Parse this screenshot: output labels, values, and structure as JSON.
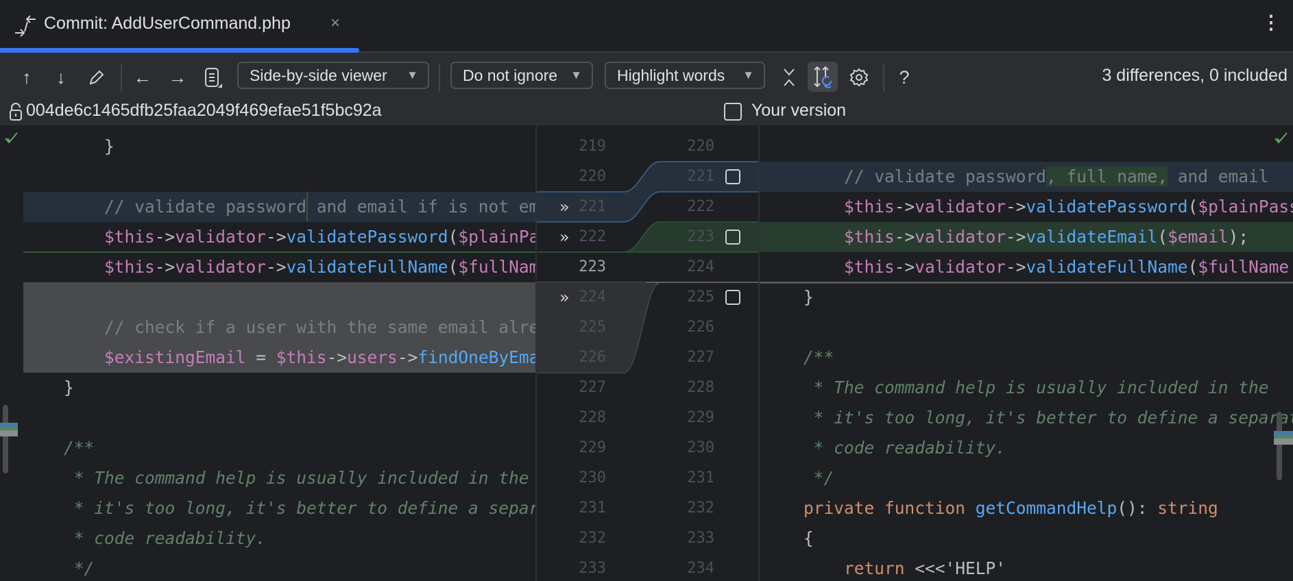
{
  "tab": {
    "title": "Commit: AddUserCommand.php",
    "close": "×",
    "more": "⋮"
  },
  "toolbar": {
    "viewer_dropdown": "Side-by-side viewer",
    "ignore_dropdown": "Do not ignore",
    "highlight_dropdown": "Highlight words",
    "help": "?",
    "status": "3 differences, 0 included"
  },
  "left_header": {
    "revision": "004de6c1465dfb25faa2049f469efae51f5bc92a"
  },
  "right_header": {
    "label": "Your version"
  },
  "colors": {
    "accent": "#3574f0",
    "modified_bg": "#25303c",
    "inserted_bg": "#283d30",
    "deleted_bg": "#484a4c"
  },
  "left_numbers": [
    "219",
    "220",
    "221",
    "222",
    "223",
    "224",
    "225",
    "226",
    "227",
    "228",
    "229",
    "230",
    "231",
    "232",
    "233"
  ],
  "right_numbers": [
    "220",
    "221",
    "222",
    "223",
    "224",
    "225",
    "226",
    "227",
    "228",
    "229",
    "230",
    "231",
    "232",
    "233",
    "234"
  ],
  "left_lines": [
    [
      [
        8,
        ""
      ],
      [
        "}",
        "op"
      ]
    ],
    [],
    [
      [
        8,
        ""
      ],
      [
        "// validate password",
        "cm"
      ],
      [
        " and email if is not empty",
        "cm"
      ]
    ],
    [
      [
        8,
        ""
      ],
      [
        "$this",
        "var"
      ],
      [
        "->",
        "op"
      ],
      [
        "validator",
        "prop"
      ],
      [
        "->",
        "op"
      ],
      [
        "validatePassword",
        "fn"
      ],
      [
        "(",
        "op"
      ],
      [
        "$plainPassword",
        "var"
      ],
      [
        ");",
        "op"
      ]
    ],
    [
      [
        8,
        ""
      ],
      [
        "$this",
        "var"
      ],
      [
        "->",
        "op"
      ],
      [
        "validator",
        "prop"
      ],
      [
        "->",
        "op"
      ],
      [
        "validateFullName",
        "fn"
      ],
      [
        "(",
        "op"
      ],
      [
        "$fullName",
        "var"
      ],
      [
        ");",
        "op"
      ]
    ],
    [],
    [
      [
        8,
        ""
      ],
      [
        "// check if a user with the same email already exists",
        "cm"
      ]
    ],
    [
      [
        8,
        ""
      ],
      [
        "$existingEmail",
        "var"
      ],
      [
        " = ",
        "op"
      ],
      [
        "$this",
        "var"
      ],
      [
        "->",
        "op"
      ],
      [
        "users",
        "prop"
      ],
      [
        "->",
        "op"
      ],
      [
        "findOneByEmail",
        "fn"
      ],
      [
        "(",
        "op"
      ]
    ],
    [
      [
        4,
        ""
      ],
      [
        "}",
        "op"
      ]
    ],
    [],
    [
      [
        4,
        ""
      ],
      [
        "/**",
        "doc"
      ]
    ],
    [
      [
        4,
        ""
      ],
      [
        " * The command help is usually included in the",
        "doc"
      ]
    ],
    [
      [
        4,
        ""
      ],
      [
        " * it's too long, it's better to define a separate",
        "doc"
      ]
    ],
    [
      [
        4,
        ""
      ],
      [
        " * code readability.",
        "doc"
      ]
    ],
    [
      [
        4,
        ""
      ],
      [
        " */",
        "doc"
      ]
    ]
  ],
  "right_lines": [
    [],
    [
      [
        8,
        ""
      ],
      [
        "// validate password",
        "cm"
      ],
      [
        ", full name,",
        "cm word-add"
      ],
      [
        " and email",
        "cm"
      ]
    ],
    [
      [
        8,
        ""
      ],
      [
        "$this",
        "var"
      ],
      [
        "->",
        "op"
      ],
      [
        "validator",
        "prop"
      ],
      [
        "->",
        "op"
      ],
      [
        "validatePassword",
        "fn"
      ],
      [
        "(",
        "op"
      ],
      [
        "$plainPassword",
        "var"
      ]
    ],
    [
      [
        8,
        ""
      ],
      [
        "$this",
        "var"
      ],
      [
        "->",
        "op"
      ],
      [
        "validator",
        "prop"
      ],
      [
        "->",
        "op"
      ],
      [
        "validateEmail",
        "fn"
      ],
      [
        "(",
        "op"
      ],
      [
        "$email",
        "var"
      ],
      [
        ");",
        "op"
      ]
    ],
    [
      [
        8,
        ""
      ],
      [
        "$this",
        "var"
      ],
      [
        "->",
        "op"
      ],
      [
        "validator",
        "prop"
      ],
      [
        "->",
        "op"
      ],
      [
        "validateFullName",
        "fn"
      ],
      [
        "(",
        "op"
      ],
      [
        "$fullName",
        "var"
      ]
    ],
    [
      [
        4,
        ""
      ],
      [
        "}",
        "op"
      ]
    ],
    [],
    [
      [
        4,
        ""
      ],
      [
        "/**",
        "doc"
      ]
    ],
    [
      [
        4,
        ""
      ],
      [
        " * The command help is usually included in the",
        "doc"
      ]
    ],
    [
      [
        4,
        ""
      ],
      [
        " * it's too long, it's better to define a separate",
        "doc"
      ]
    ],
    [
      [
        4,
        ""
      ],
      [
        " * code readability.",
        "doc"
      ]
    ],
    [
      [
        4,
        ""
      ],
      [
        " */",
        "doc"
      ]
    ],
    [
      [
        4,
        ""
      ],
      [
        "private function ",
        "kw"
      ],
      [
        "getCommandHelp",
        "fn"
      ],
      [
        "(): ",
        "op"
      ],
      [
        "string",
        "kw"
      ]
    ],
    [
      [
        4,
        ""
      ],
      [
        "{",
        "op"
      ]
    ],
    [
      [
        8,
        ""
      ],
      [
        "return ",
        "kw"
      ],
      [
        "<<<'HELP'",
        "op"
      ]
    ]
  ]
}
